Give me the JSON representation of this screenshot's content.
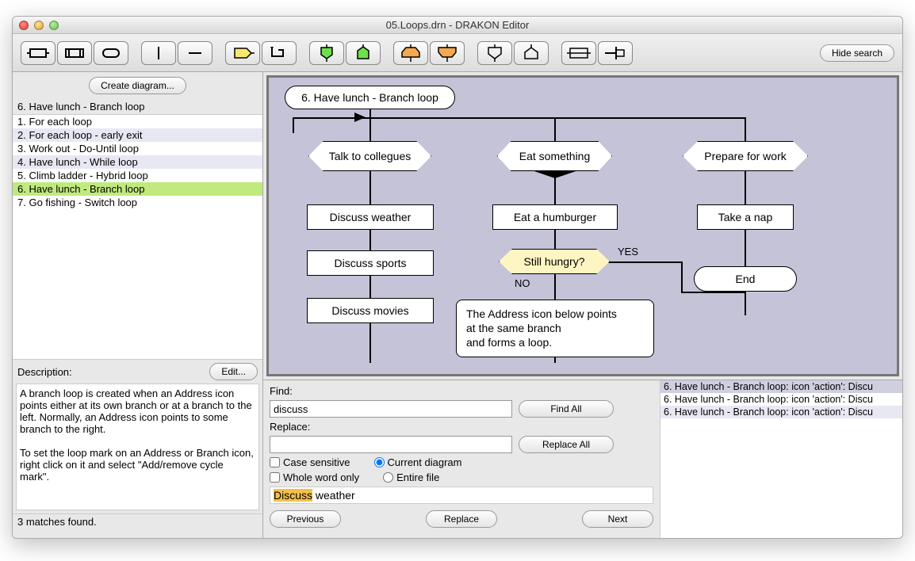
{
  "window_title": "05.Loops.drn - DRAKON Editor",
  "hide_search": "Hide search",
  "create_diagram": "Create diagram...",
  "selected_title": "6. Have lunch - Branch loop",
  "diagram_list": [
    "1. For each loop",
    "2. For each loop - early exit",
    "3. Work out - Do-Until loop",
    "4. Have lunch - While loop",
    "5. Climb ladder - Hybrid loop",
    "6. Have lunch - Branch loop",
    "7. Go fishing - Switch loop"
  ],
  "desc_label": "Description:",
  "edit_label": "Edit...",
  "description": "A branch loop is created when an Address icon points either at its own branch or at a branch to the left. Normally, an Address icon points to some branch to the right.\n\nTo set the loop mark on an Address or Branch icon, right click on it and select \"Add/remove cycle mark\".",
  "status": "3 matches found.",
  "canvas": {
    "title": "6. Have lunch - Branch loop",
    "talk": "Talk to collegues",
    "eat": "Eat something",
    "prepare": "Prepare for work",
    "weather": "Discuss weather",
    "hamburger": "Eat a humburger",
    "nap": "Take a nap",
    "sports": "Discuss sports",
    "hungry": "Still hungry?",
    "end": "End",
    "movies": "Discuss movies",
    "comment": "The Address icon below points\nat the same branch\nand forms a loop.",
    "yes": "YES",
    "no": "NO"
  },
  "search": {
    "find_label": "Find:",
    "find_value": "discuss",
    "find_all": "Find All",
    "replace_label": "Replace:",
    "replace_value": "",
    "replace_all": "Replace All",
    "case": "Case sensitive",
    "whole": "Whole word only",
    "current": "Current diagram",
    "entire": "Entire file",
    "match_pre": "Discuss",
    "match_post": " weather",
    "prev": "Previous",
    "replace": "Replace",
    "next": "Next"
  },
  "results": [
    "6. Have lunch - Branch loop: icon 'action': Discu",
    "6. Have lunch - Branch loop: icon 'action': Discu",
    "6. Have lunch - Branch loop: icon 'action': Discu"
  ]
}
